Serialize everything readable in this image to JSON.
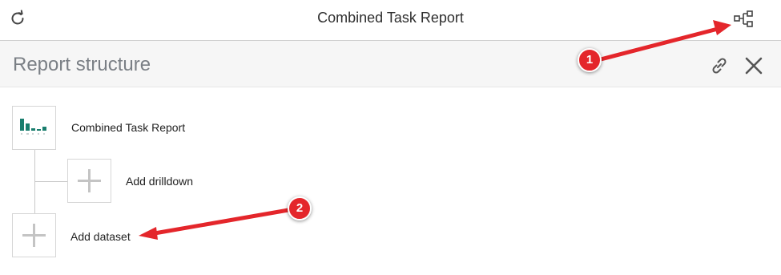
{
  "topbar": {
    "title": "Combined Task Report",
    "refresh_icon": "refresh-icon",
    "structure_icon": "report-structure-icon"
  },
  "panel": {
    "title": "Report structure",
    "link_icon": "link-icon",
    "close_icon": "close-icon"
  },
  "tree": {
    "root_label": "Combined Task Report",
    "thumbnail_icon": "bar-chart-thumbnail-icon",
    "drilldown_label": "Add drilldown",
    "dataset_label": "Add dataset",
    "add_icon": "plus-icon"
  },
  "annotations": {
    "callout_1": "1",
    "callout_2": "2",
    "color": "#e4262b"
  },
  "colors": {
    "thumbnail_bars": "#1a7e6e",
    "panel_header_bg": "#f6f6f6"
  }
}
